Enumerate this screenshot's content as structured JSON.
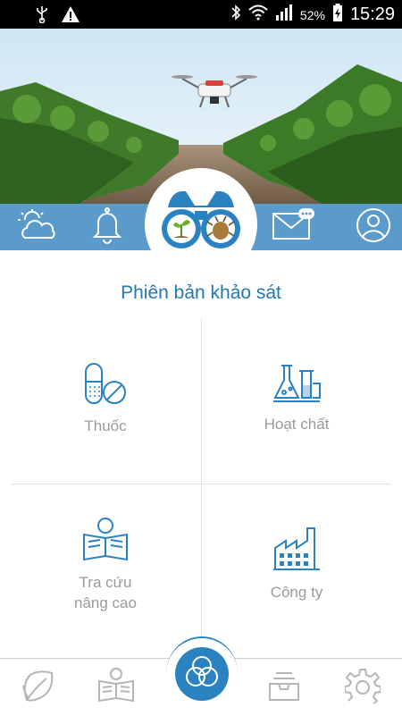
{
  "status_bar": {
    "battery_percent": "52%",
    "time": "15:29",
    "icons": [
      "usb-icon",
      "warning-icon",
      "bluetooth-icon",
      "wifi-icon",
      "signal-icon",
      "battery-icon"
    ]
  },
  "top_toolbar": {
    "icons": [
      "weather-icon",
      "bell-icon",
      "binoculars-icon",
      "message-icon",
      "profile-icon"
    ]
  },
  "main": {
    "title": "Phiên bản khảo sát",
    "tiles": [
      {
        "label": "Thuốc",
        "icon": "pills-icon"
      },
      {
        "label": "Hoạt chất",
        "icon": "flasks-icon"
      },
      {
        "label_line1": "Tra cứu",
        "label_line2": "nâng cao",
        "icon": "reader-icon"
      },
      {
        "label": "Công ty",
        "icon": "factory-icon"
      }
    ]
  },
  "bottom_nav": {
    "icons": [
      "leaf-icon",
      "book-icon",
      "circles-icon",
      "inbox-icon",
      "settings-icon"
    ]
  },
  "colors": {
    "accent": "#2a82c0",
    "toolbar": "#5b9bcb",
    "title": "#2278b5",
    "label_gray": "#9a9a9a"
  }
}
